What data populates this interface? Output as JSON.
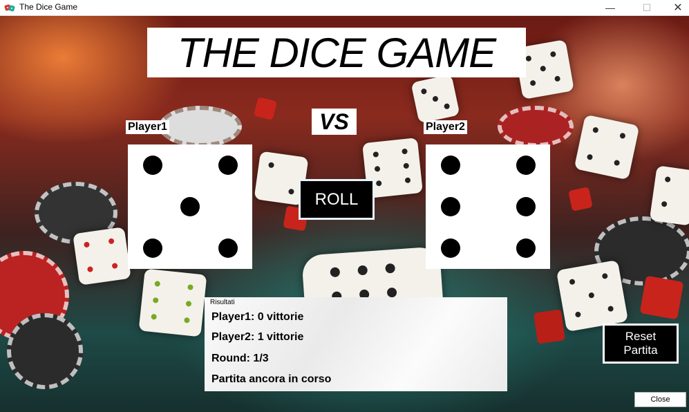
{
  "window": {
    "title": "The Dice Game",
    "minimize_glyph": "—",
    "maximize_glyph": "☐",
    "close_glyph": "✕",
    "icon": "dice-icon"
  },
  "game": {
    "title": "THE DICE GAME",
    "vs": "VS",
    "player1_label": "Player1",
    "player2_label": "Player2",
    "player1_die_value": 5,
    "player2_die_value": 6,
    "roll_label": "ROLL"
  },
  "results": {
    "caption": "Risultati",
    "player1_wins": "Player1: 0 vittorie",
    "player2_wins": "Player2: 1 vittorie",
    "round": "Round: 1/3",
    "status": "Partita ancora in corso"
  },
  "buttons": {
    "reset_label": "Reset\nPartita",
    "close_label": "Close"
  }
}
